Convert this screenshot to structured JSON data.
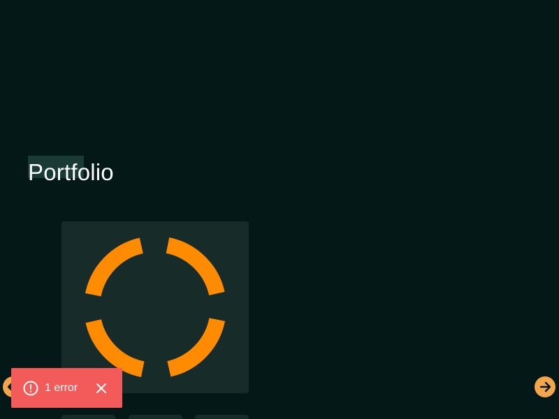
{
  "page": {
    "title": "Portfolio"
  },
  "preview": {
    "icon": "lifebuoy-icon",
    "accent_color": "#ff8c00"
  },
  "carousel": {
    "prev_icon": "arrow-left-icon",
    "next_icon": "arrow-right-icon",
    "button_color": "#f4a64a"
  },
  "error_toast": {
    "icon": "alert-circle-icon",
    "text": "1 error",
    "close_icon": "close-icon",
    "background": "#f35a5a"
  },
  "colors": {
    "background": "#041917",
    "card": "#172b29"
  }
}
